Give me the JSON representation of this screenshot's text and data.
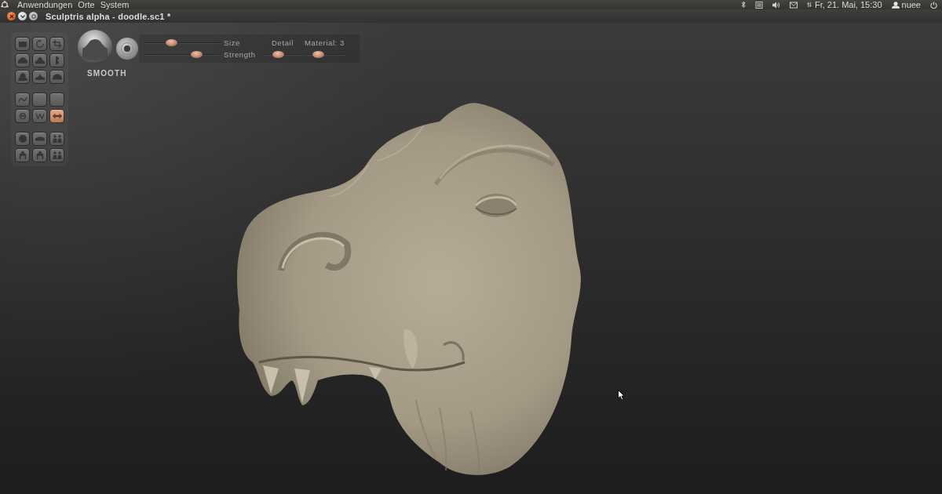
{
  "top_panel": {
    "menus": [
      "Anwendungen",
      "Orte",
      "System"
    ],
    "clock": "Fr, 21. Mai, 15:30",
    "user": "nuee"
  },
  "window": {
    "title": "Sculptris alpha - doodle.sc1 *"
  },
  "tool_panel": {
    "groups": [
      {
        "buttons": [
          {
            "selected": false
          },
          {
            "selected": false
          },
          {
            "selected": false
          },
          {
            "selected": false
          },
          {
            "selected": false
          },
          {
            "selected": false
          },
          {
            "selected": false
          },
          {
            "selected": false
          },
          {
            "selected": false
          }
        ]
      },
      {
        "buttons": [
          {
            "selected": false
          },
          {
            "selected": false
          },
          {
            "selected": false
          },
          {
            "selected": false
          },
          {
            "selected": false
          },
          {
            "selected": true
          }
        ]
      },
      {
        "buttons": [
          {
            "selected": false
          },
          {
            "selected": false
          },
          {
            "selected": false
          },
          {
            "selected": false
          },
          {
            "selected": false
          },
          {
            "selected": false
          }
        ]
      }
    ]
  },
  "brush": {
    "name": "SMOOTH"
  },
  "sliders": [
    {
      "label": "Size",
      "level": 0.33
    },
    {
      "label": "Strength",
      "level": 0.71
    },
    {
      "label": "Detail",
      "level": 0.34
    },
    {
      "label": "Material: 3",
      "level": 0.24
    }
  ]
}
